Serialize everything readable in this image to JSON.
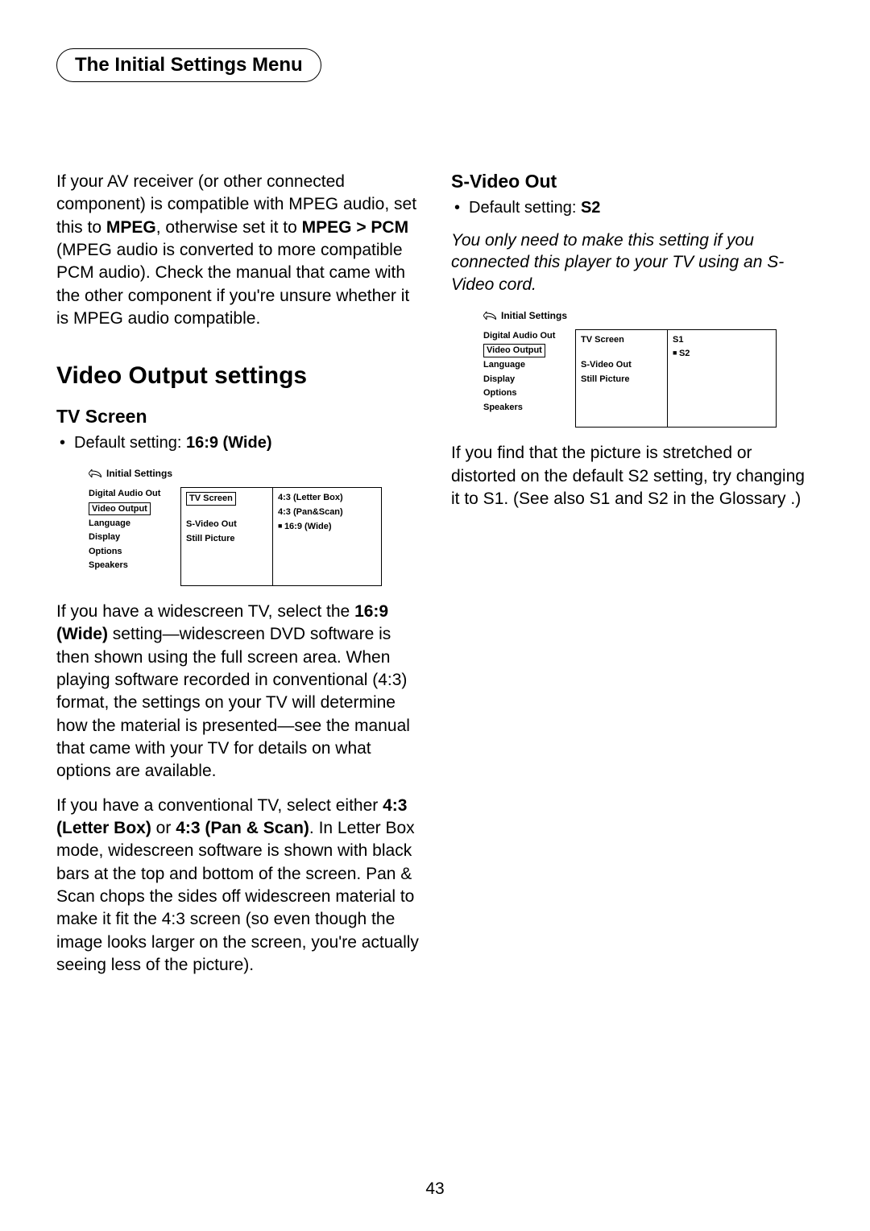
{
  "header": {
    "tab": "The Initial Settings Menu"
  },
  "left": {
    "p1a": "If your AV receiver (or other connected component) is compatible with MPEG audio, set this to ",
    "p1b": "MPEG",
    "p1c": ", otherwise set it to ",
    "p1d": "MPEG > PCM",
    "p1e": " (MPEG audio is converted to more compatible PCM audio). Check the manual that came with the other component if you're unsure whether it is MPEG audio compatible.",
    "h2": "Video Output settings",
    "h3": "TV Screen",
    "bullet_a": "Default setting: ",
    "bullet_b": "16:9 (Wide)",
    "p2a": "If you have a widescreen TV, select the ",
    "p2b": "16:9 (Wide)",
    "p2c": " setting—widescreen DVD software is then shown using the full screen area. When playing software recorded in conventional (4:3) format, the settings on your TV will determine how the material is presented—see the manual that came with your TV for details on what options are available.",
    "p3a": "If you have a conventional TV, select either ",
    "p3b": "4:3 (Letter Box)",
    "p3c": " or ",
    "p3d": "4:3 (Pan & Scan)",
    "p3e": ". In Letter Box mode, widescreen software is shown with black bars at the top and bottom of the screen. Pan & Scan chops the sides off widescreen material to make it fit the 4:3 screen (so even though the image looks larger on the screen, you're actually seeing less of the picture)."
  },
  "right": {
    "h3": "S-Video Out",
    "bullet_a": "Default setting: ",
    "bullet_b": "S2",
    "ital": "You only need to make this setting if you connected this player to your TV using an S-Video cord.",
    "p1": "If you find that the picture is stretched or distorted on the default S2 setting, try changing it to S1. (See also S1 and S2 in the Glossary .)"
  },
  "panel": {
    "title": "Initial Settings",
    "left_items": [
      "Digital Audio Out",
      "Video Output",
      "Language",
      "Display",
      "Options",
      "Speakers"
    ],
    "mid_items": [
      "TV Screen",
      "S-Video Out",
      "Still Picture"
    ],
    "tvscreen_right": [
      "4:3 (Letter Box)",
      "4:3 (Pan&Scan)",
      "16:9 (Wide)"
    ],
    "svideo_right": [
      "S1",
      "S2"
    ]
  },
  "page": "43"
}
